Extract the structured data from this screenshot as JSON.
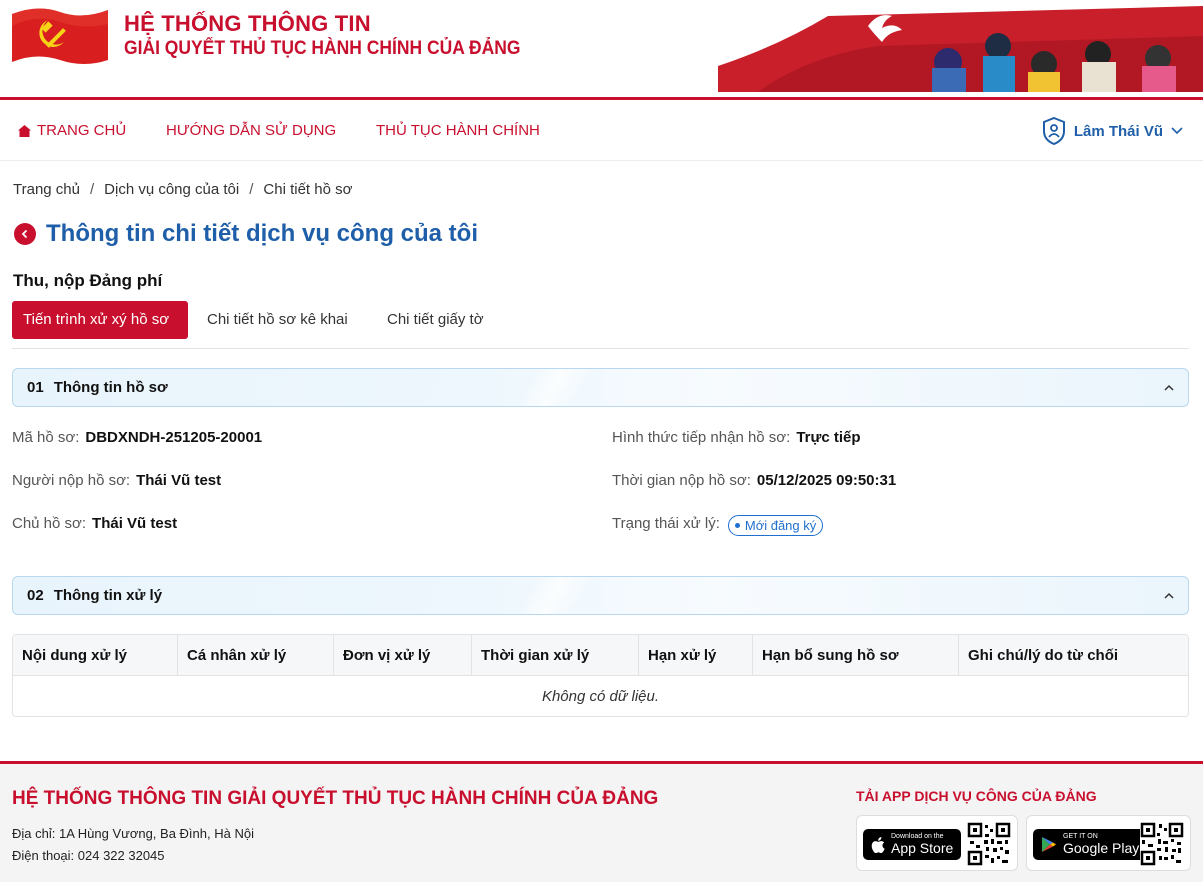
{
  "header": {
    "title_line1": "HỆ THỐNG THÔNG TIN",
    "title_line2": "GIẢI QUYẾT THỦ TỤC HÀNH CHÍNH CỦA ĐẢNG"
  },
  "nav": {
    "home": "TRANG CHỦ",
    "guide": "HƯỚNG DẪN SỬ DỤNG",
    "procedures": "THỦ TỤC HÀNH CHÍNH",
    "user_name": "Lâm Thái Vũ"
  },
  "breadcrumb": {
    "items": [
      "Trang chủ",
      "Dịch vụ công của tôi",
      "Chi tiết hồ sơ"
    ],
    "separator": "/"
  },
  "page": {
    "title": "Thông tin chi tiết dịch vụ công của tôi",
    "service_name": "Thu, nộp Đảng phí"
  },
  "tabs": [
    {
      "label": "Tiến trình xử xý hồ sơ",
      "active": true
    },
    {
      "label": "Chi tiết hồ sơ kê khai",
      "active": false
    },
    {
      "label": "Chi tiết giấy tờ",
      "active": false
    }
  ],
  "section1": {
    "num": "01",
    "title": "Thông tin hồ sơ",
    "fields": {
      "ma_ho_so": {
        "key": "Mã hồ sơ:",
        "value": "DBDXNDH-251205-20001"
      },
      "nguoi_nop": {
        "key": "Người nộp hồ sơ:",
        "value": "Thái Vũ test"
      },
      "chu_ho_so": {
        "key": "Chủ hồ sơ:",
        "value": "Thái Vũ test"
      },
      "hinh_thuc": {
        "key": "Hình thức tiếp nhận hồ sơ:",
        "value": "Trực tiếp"
      },
      "thoi_gian": {
        "key": "Thời gian nộp hồ sơ:",
        "value": "05/12/2025 09:50:31"
      },
      "trang_thai": {
        "key": "Trạng thái xử lý:",
        "value": "Mới đăng ký"
      }
    }
  },
  "section2": {
    "num": "02",
    "title": "Thông tin xử lý",
    "columns": [
      "Nội dung xử lý",
      "Cá nhân xử lý",
      "Đơn vị xử lý",
      "Thời gian xử lý",
      "Hạn xử lý",
      "Hạn bổ sung hồ sơ",
      "Ghi chú/lý do từ chối"
    ],
    "empty_text": "Không có dữ liệu."
  },
  "footer": {
    "title": "HỆ THỐNG THÔNG TIN GIẢI QUYẾT THỦ TỤC HÀNH CHÍNH CỦA ĐẢNG",
    "address": "Địa chỉ: 1A Hùng Vương, Ba Đình, Hà Nội",
    "phone": "Điện thoại: 024 322 32045",
    "app_title": "TẢI APP DỊCH VỤ CÔNG CỦA ĐẢNG",
    "apple_small": "Download on the",
    "apple_big": "App Store",
    "google_small": "GET IT ON",
    "google_big": "Google Play"
  },
  "colors": {
    "brand_red": "#c8102e",
    "link_blue": "#1f5ea8",
    "status_blue": "#1f6fd1"
  },
  "icons": [
    "hammer-sickle-flag-icon",
    "home-icon",
    "user-shield-icon",
    "chevron-down-icon",
    "back-arrow-icon",
    "chevron-up-icon",
    "apple-icon",
    "google-play-icon",
    "qr-code-icon"
  ]
}
